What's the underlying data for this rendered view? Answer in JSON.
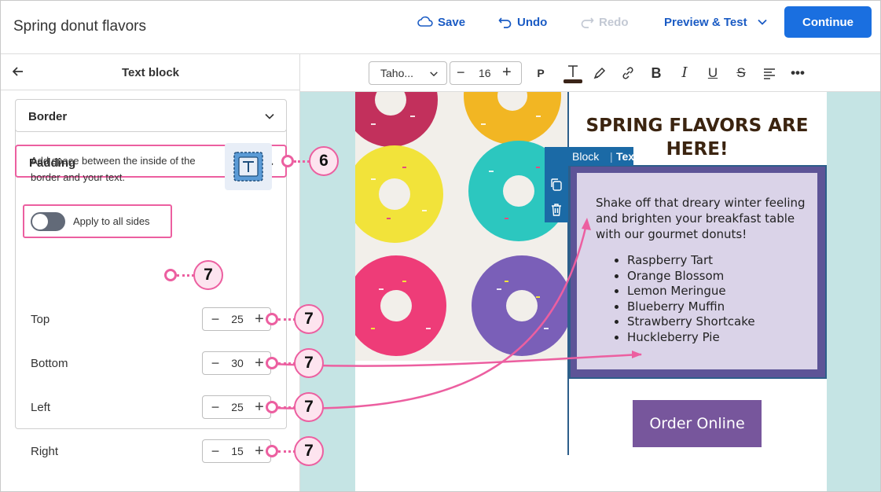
{
  "header": {
    "title": "Spring donut flavors",
    "save_label": "Save",
    "undo_label": "Undo",
    "redo_label": "Redo",
    "preview_label": "Preview & Test",
    "continue_label": "Continue"
  },
  "panel": {
    "title": "Text block",
    "border_label": "Border",
    "padding_label": "Padding",
    "description": "Add space between the inside of the border and your text.",
    "toggle_label": "Apply to all sides",
    "sides": [
      {
        "label": "Top",
        "value": "25"
      },
      {
        "label": "Bottom",
        "value": "30"
      },
      {
        "label": "Left",
        "value": "25"
      },
      {
        "label": "Right",
        "value": "15"
      }
    ]
  },
  "toolbar": {
    "font": "Taho...",
    "size": "16",
    "paragraph": "P"
  },
  "email": {
    "heading": "SPRING FLAVORS ARE HERE!",
    "block_tag": "Block",
    "text_tag": "Text",
    "paragraph": "Shake off that dreary winter feeling and brighten your breakfast table with our gourmet donuts!",
    "flavors": [
      "Raspberry Tart",
      "Orange Blossom",
      "Lemon Meringue",
      "Blueberry Muffin",
      "Strawberry Shortcake",
      "Huckleberry Pie"
    ],
    "button": "Order Online"
  },
  "callouts": {
    "padding_step": "6",
    "sides_step": "7"
  },
  "colors": {
    "accent": "#1a6fe0",
    "callout": "#ec5fa0",
    "block_border": "#5d5497",
    "block_fill": "#dad3e8",
    "button": "#77569c",
    "canvas": "#c5e4e4"
  }
}
